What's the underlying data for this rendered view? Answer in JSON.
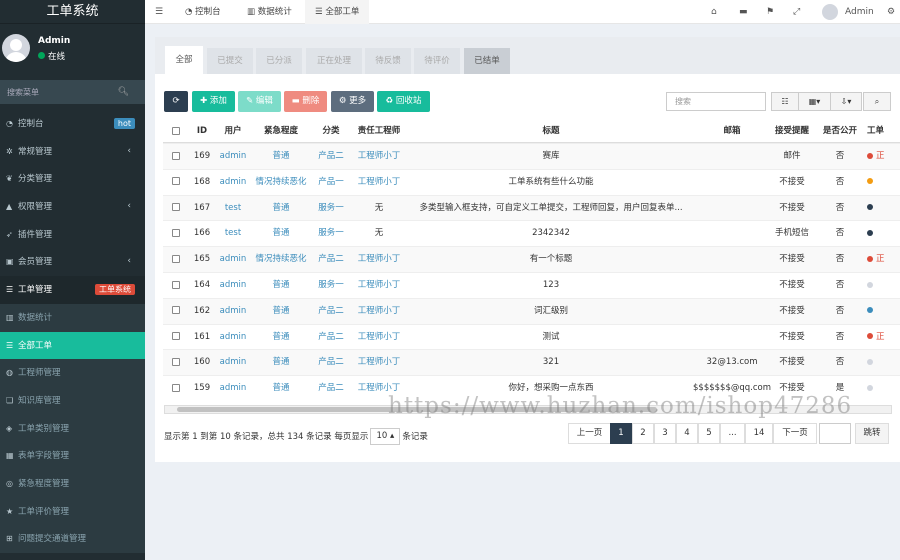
{
  "sidebar": {
    "title": "工单系统",
    "user_name": "Admin",
    "user_status": "在线",
    "search_placeholder": "搜索菜单",
    "items": [
      {
        "label": "控制台",
        "icon": "dashboard-icon",
        "badge": "hot",
        "badge_color": "#3c8dbc"
      },
      {
        "label": "常规管理",
        "icon": "cogs-icon",
        "arrow": "‹"
      },
      {
        "label": "分类管理",
        "icon": "leaf-icon"
      },
      {
        "label": "权限管理",
        "icon": "group-icon",
        "arrow": "‹"
      },
      {
        "label": "插件管理",
        "icon": "rocket-icon"
      },
      {
        "label": "会员管理",
        "icon": "user-icon",
        "arrow": "‹"
      },
      {
        "label": "工单管理",
        "icon": "list-icon",
        "badge": "工单系统",
        "badge_color": "#dd4b39"
      },
      {
        "label": "数据统计",
        "icon": "chart-icon"
      },
      {
        "label": "全部工单",
        "icon": "list-icon"
      },
      {
        "label": "工程师管理",
        "icon": "users-icon"
      },
      {
        "label": "知识库管理",
        "icon": "book-icon"
      },
      {
        "label": "工单类别管理",
        "icon": "tag-icon"
      },
      {
        "label": "表单字段管理",
        "icon": "table-icon"
      },
      {
        "label": "紧急程度管理",
        "icon": "gauge-icon"
      },
      {
        "label": "工单评价管理",
        "icon": "star-icon"
      },
      {
        "label": "问题提交通道管理",
        "icon": "channel-icon"
      }
    ]
  },
  "topbar": {
    "menu_icon": "bars-icon",
    "tabs": [
      {
        "label": "控制台",
        "icon": "dashboard-icon"
      },
      {
        "label": "数据统计",
        "icon": "chart-icon"
      },
      {
        "label": "全部工单",
        "icon": "list-icon"
      }
    ],
    "right_icons": [
      "home-icon",
      "trash-icon",
      "translate-icon",
      "fullscreen-icon"
    ],
    "admin": "Admin"
  },
  "status_tabs": [
    "全部",
    "已提交",
    "已分派",
    "正在处理",
    "待反馈",
    "待评价",
    "已结单"
  ],
  "toolbar": {
    "refresh": "",
    "add": "添加",
    "edit": "编辑",
    "delete": "删除",
    "more": "更多",
    "recycle": "回收站",
    "search_placeholder": "搜索"
  },
  "table": {
    "headers": [
      "ID",
      "用户",
      "紧急程度",
      "分类",
      "责任工程师",
      "标题",
      "邮箱",
      "接受提醒",
      "是否公开",
      "工单"
    ],
    "rows": [
      {
        "id": "169",
        "user": "admin",
        "urgency": "普通",
        "category": "产品二",
        "engineer": "工程师小丁",
        "title": "赛库",
        "email": "",
        "remind": "邮件",
        "public": "否",
        "status_color": "#dd4b39",
        "status": "正"
      },
      {
        "id": "168",
        "user": "admin",
        "urgency": "情况持续恶化",
        "category": "产品一",
        "engineer": "工程师小丁",
        "title": "工单系统有些什么功能",
        "email": "",
        "remind": "不接受",
        "public": "否",
        "status_color": "#f39c12",
        "status": ""
      },
      {
        "id": "167",
        "user": "test",
        "urgency": "普通",
        "category": "服务一",
        "engineer": "无",
        "title": "多类型输入框支持，可自定义工单提交，工程师回复，用户回复表单...",
        "email": "",
        "remind": "不接受",
        "public": "否",
        "status_color": "#2c3e50",
        "status": ""
      },
      {
        "id": "166",
        "user": "test",
        "urgency": "普通",
        "category": "服务一",
        "engineer": "无",
        "title": "2342342",
        "email": "",
        "remind": "手机短信",
        "public": "否",
        "status_color": "#2c3e50",
        "status": ""
      },
      {
        "id": "165",
        "user": "admin",
        "urgency": "情况持续恶化",
        "category": "产品二",
        "engineer": "工程师小丁",
        "title": "有一个标题",
        "email": "",
        "remind": "不接受",
        "public": "否",
        "status_color": "#dd4b39",
        "status": "正"
      },
      {
        "id": "164",
        "user": "admin",
        "urgency": "普通",
        "category": "服务一",
        "engineer": "工程师小丁",
        "title": "123",
        "email": "",
        "remind": "不接受",
        "public": "否",
        "status_color": "#d2d6de",
        "status": ""
      },
      {
        "id": "162",
        "user": "admin",
        "urgency": "普通",
        "category": "产品二",
        "engineer": "工程师小丁",
        "title": "词汇级别",
        "email": "",
        "remind": "不接受",
        "public": "否",
        "status_color": "#3c8dbc",
        "status": ""
      },
      {
        "id": "161",
        "user": "admin",
        "urgency": "普通",
        "category": "产品二",
        "engineer": "工程师小丁",
        "title": "测试",
        "email": "",
        "remind": "不接受",
        "public": "否",
        "status_color": "#dd4b39",
        "status": "正"
      },
      {
        "id": "160",
        "user": "admin",
        "urgency": "普通",
        "category": "产品二",
        "engineer": "工程师小丁",
        "title": "321",
        "email": "32@13.com",
        "remind": "不接受",
        "public": "否",
        "status_color": "#d2d6de",
        "status": ""
      },
      {
        "id": "159",
        "user": "admin",
        "urgency": "普通",
        "category": "产品二",
        "engineer": "工程师小丁",
        "title": "你好，想采购一点东西",
        "email": "$$$$$$$@qq.com",
        "remind": "不接受",
        "public": "是",
        "status_color": "#d2d6de",
        "status": ""
      }
    ]
  },
  "pagination": {
    "info_prefix": "显示第 1 到第 10 条记录，总共 134 条记录 每页显示",
    "per_page": "10",
    "info_suffix": "条记录",
    "prev": "上一页",
    "pages": [
      "1",
      "2",
      "3",
      "4",
      "5",
      "...",
      "14"
    ],
    "next": "下一页",
    "jump": "跳转"
  },
  "watermark": "https://www.huzhan.com/ishop47286"
}
